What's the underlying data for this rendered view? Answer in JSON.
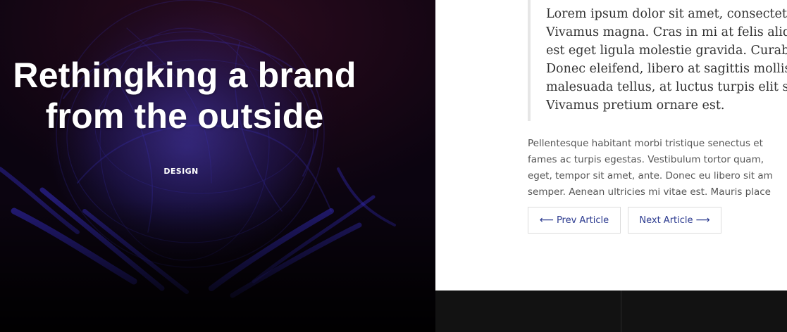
{
  "hero": {
    "title_lines": [
      "Rethingking a brand",
      "from the outside"
    ],
    "category": "DESIGN"
  },
  "article": {
    "quote_lines": [
      "Lorem ipsum dolor sit amet, consectetu",
      "Vivamus magna. Cras in mi at felis aliqu",
      "est eget ligula molestie gravida. Curabit",
      "Donec eleifend, libero at sagittis mollis,",
      "malesuada tellus, at luctus turpis elit sit",
      "Vivamus pretium ornare est."
    ],
    "paragraph_lines": [
      "Pellentesque habitant morbi tristique senectus et",
      "fames ac turpis egestas. Vestibulum tortor quam,",
      "eget, tempor sit amet, ante. Donec eu libero sit am",
      "semper. Aenean ultricies mi vitae est. Mauris place"
    ],
    "prev_label": "Prev Article",
    "next_label": "Next Article"
  },
  "icons": {
    "prev": "arrow-left-icon",
    "next": "arrow-right-icon"
  },
  "colors": {
    "accent": "#2b3a8f",
    "footer_bg": "#121212",
    "hero_glow": "#3a2fb0"
  }
}
